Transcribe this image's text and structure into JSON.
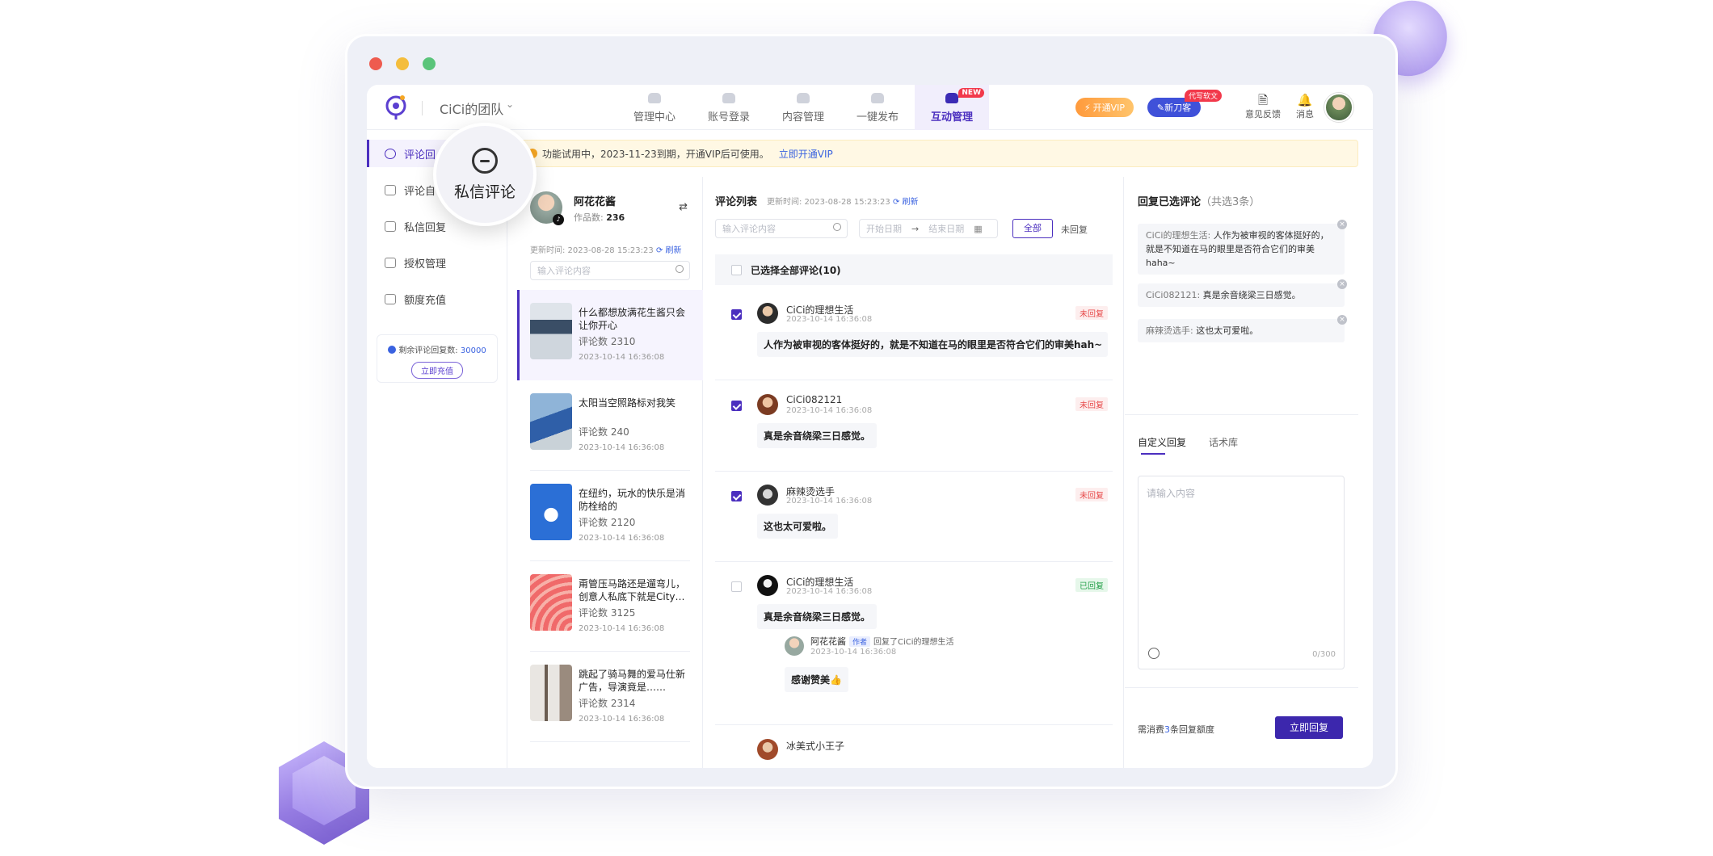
{
  "header": {
    "team_name": "CiCi的团队",
    "caret": "⌄",
    "nav": [
      {
        "label": "管理中心",
        "active": false
      },
      {
        "label": "账号登录",
        "active": false
      },
      {
        "label": "内容管理",
        "active": false
      },
      {
        "label": "一键发布",
        "active": false
      },
      {
        "label": "互动管理",
        "active": true
      }
    ],
    "new_badge": "NEW",
    "vip_label": "开通VIP",
    "nova_label": "新刀客",
    "nova_badge": "代写软文",
    "feedback_label": "意见反馈",
    "message_label": "消息"
  },
  "sidebar": {
    "items": [
      {
        "label": "评论回",
        "active": true
      },
      {
        "label": "评论自",
        "active": false
      },
      {
        "label": "私信回复",
        "active": false
      },
      {
        "label": "授权管理",
        "active": false
      },
      {
        "label": "额度充值",
        "active": false
      }
    ],
    "quota_label": "剩余评论回复数:",
    "quota_value": "30000",
    "recharge_label": "立即充值"
  },
  "magnifier": {
    "label": "私信评论"
  },
  "notice": {
    "text": "功能试用中，2023-11-23到期，开通VIP后可使用。",
    "link": "立即开通VIP"
  },
  "account": {
    "name": "阿花花酱",
    "works_label": "作品数:",
    "works_count": "236",
    "update_time": "更新时间: 2023-08-28 15:23:23",
    "refresh": "刷新",
    "search_placeholder": "输入评论内容"
  },
  "posts": [
    {
      "title": "什么都想放满花生酱只会让你开心",
      "count": "评论数 2310",
      "time": "2023-10-14 16:36:08"
    },
    {
      "title": "太阳当空照路标对我笑",
      "count": "评论数 240",
      "time": "2023-10-14 16:36:08"
    },
    {
      "title": "在纽约，玩水的快乐是消防栓给的",
      "count": "评论数 2120",
      "time": "2023-10-14 16:36:08"
    },
    {
      "title": "甭管压马路还是遛弯儿，创意人私底下就是City…",
      "count": "评论数 3125",
      "time": "2023-10-14 16:36:08"
    },
    {
      "title": "跳起了骑马舞的爱马仕新广告，导演竟是……",
      "count": "评论数 2314",
      "time": "2023-10-14 16:36:08"
    }
  ],
  "comment_list": {
    "title": "评论列表",
    "update_time": "更新时间: 2023-08-28 15:23:23",
    "refresh": "刷新",
    "search_placeholder": "输入评论内容",
    "start_date": "开始日期",
    "arrow": "→",
    "end_date": "结束日期",
    "filter_all": "全部",
    "filter_unreplied": "未回复",
    "select_all": "已选择全部评论(10)",
    "comments": [
      {
        "name": "CiCi的理想生活",
        "time": "2023-10-14 16:36:08",
        "status": "未回复",
        "text": "人作为被审视的客体挺好的，就是不知道在马的眼里是否符合它们的审美hah~"
      },
      {
        "name": "CiCi082121",
        "time": "2023-10-14 16:36:08",
        "status": "未回复",
        "text": "真是余音绕梁三日感觉。"
      },
      {
        "name": "麻辣烫选手",
        "time": "2023-10-14 16:36:08",
        "status": "未回复",
        "text": "这也太可爱啦。"
      },
      {
        "name": "CiCi的理想生活",
        "time": "2023-10-14 16:36:08",
        "status": "已回复",
        "text": "真是余音绕梁三日感觉。",
        "reply": {
          "name": "阿花花酱",
          "tag": "作者",
          "to": "回复了CiCi的理想生活",
          "time": "2023-10-14 16:36:08",
          "text": "感谢赞美👍"
        }
      },
      {
        "name": "冰美式小王子",
        "time": "",
        "status": "",
        "text": ""
      }
    ]
  },
  "reply_panel": {
    "title": "回复已选评论",
    "count": "（共选3条）",
    "selected": [
      {
        "who": "CiCi的理想生活:",
        "text": "人作为被审视的客体挺好的，就是不知道在马的眼里是否符合它们的审美haha~"
      },
      {
        "who": "CiCi082121:",
        "text": "真是余音绕梁三日感觉。"
      },
      {
        "who": "麻辣烫选手:",
        "text": "这也太可爱啦。"
      }
    ],
    "tab_custom": "自定义回复",
    "tab_library": "话术库",
    "placeholder": "请输入内容",
    "char_count": "0/300",
    "cost_prefix": "需消费",
    "cost_num": "3",
    "cost_suffix": "条回复额度",
    "reply_button": "立即回复"
  }
}
